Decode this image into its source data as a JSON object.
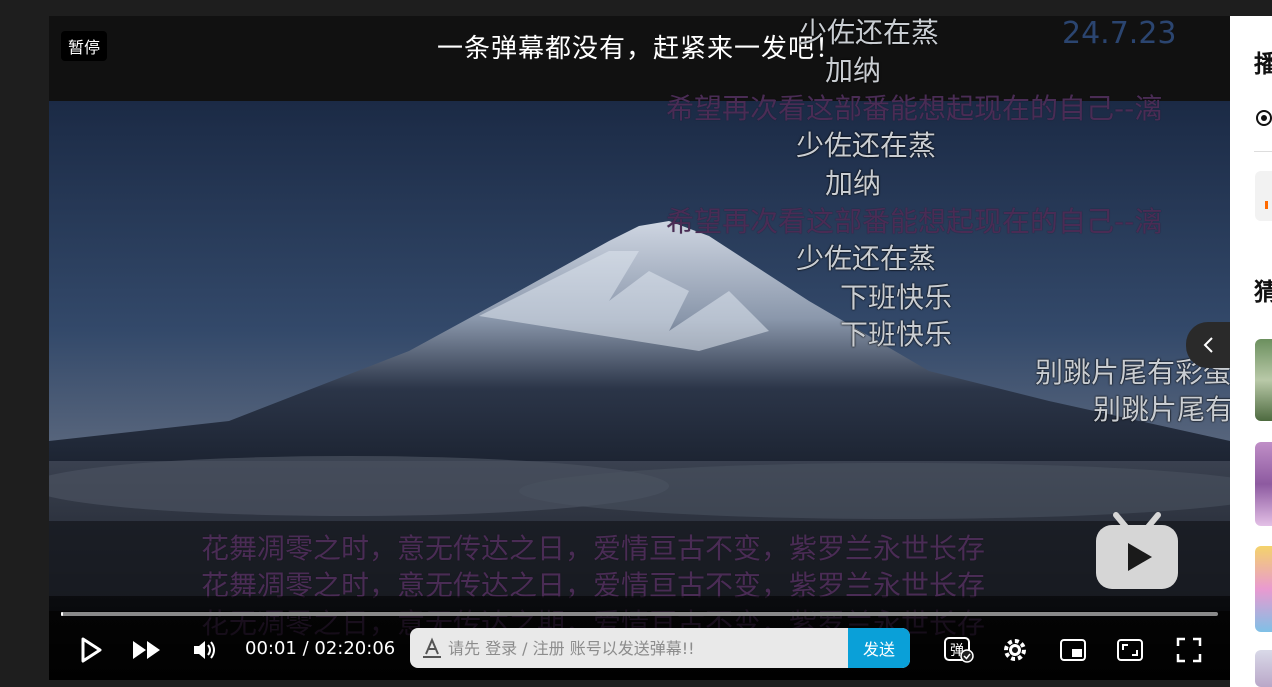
{
  "player": {
    "pause_badge": "暂停",
    "no_danmaku_notice": "一条弹幕都没有，赶紧来一发吧！",
    "progress_fraction": 0.0001
  },
  "danmaku": [
    {
      "text": "少佐还在蒸",
      "style": "white"
    },
    {
      "text": "24.7.23",
      "style": "blue"
    },
    {
      "text": "加纳",
      "style": "white"
    },
    {
      "text": "希望再次看这部番能想起现在的自己--漓",
      "style": "purple"
    },
    {
      "text": "少佐还在蒸",
      "style": "white"
    },
    {
      "text": "加纳",
      "style": "white"
    },
    {
      "text": "希望再次看这部番能想起现在的自己--漓",
      "style": "purple"
    },
    {
      "text": "少佐还在蒸",
      "style": "white"
    },
    {
      "text": "下班快乐",
      "style": "white"
    },
    {
      "text": "下班快乐",
      "style": "white"
    },
    {
      "text": "别跳片尾有彩蛋",
      "style": "white"
    },
    {
      "text": "别跳片尾有",
      "style": "white"
    },
    {
      "text": "花舞凋零之时，意无传达之日，爱情亘古不变，紫罗兰永世长存",
      "style": "purple"
    },
    {
      "text": "花舞凋零之时，意无传达之日，爱情亘古不变，紫罗兰永世长存",
      "style": "purple"
    },
    {
      "text": "花无凋零之日，意无传达之期，爱情亘古不变，紫罗兰永世长存",
      "style": "purple"
    }
  ],
  "controls": {
    "time": "00:01 / 02:20:06",
    "danmaku_placeholder": "请先 登录 / 注册 账号以发送弹幕!!",
    "send_label": "发送",
    "danmaku_toggle_label": "弹"
  },
  "sidebar": {
    "title_1": "播",
    "title_2": "猜"
  },
  "colors": {
    "send_button": "#0aa0d8",
    "danmaku_purple": "#4a2c55",
    "danmaku_blue": "#2b4570"
  }
}
